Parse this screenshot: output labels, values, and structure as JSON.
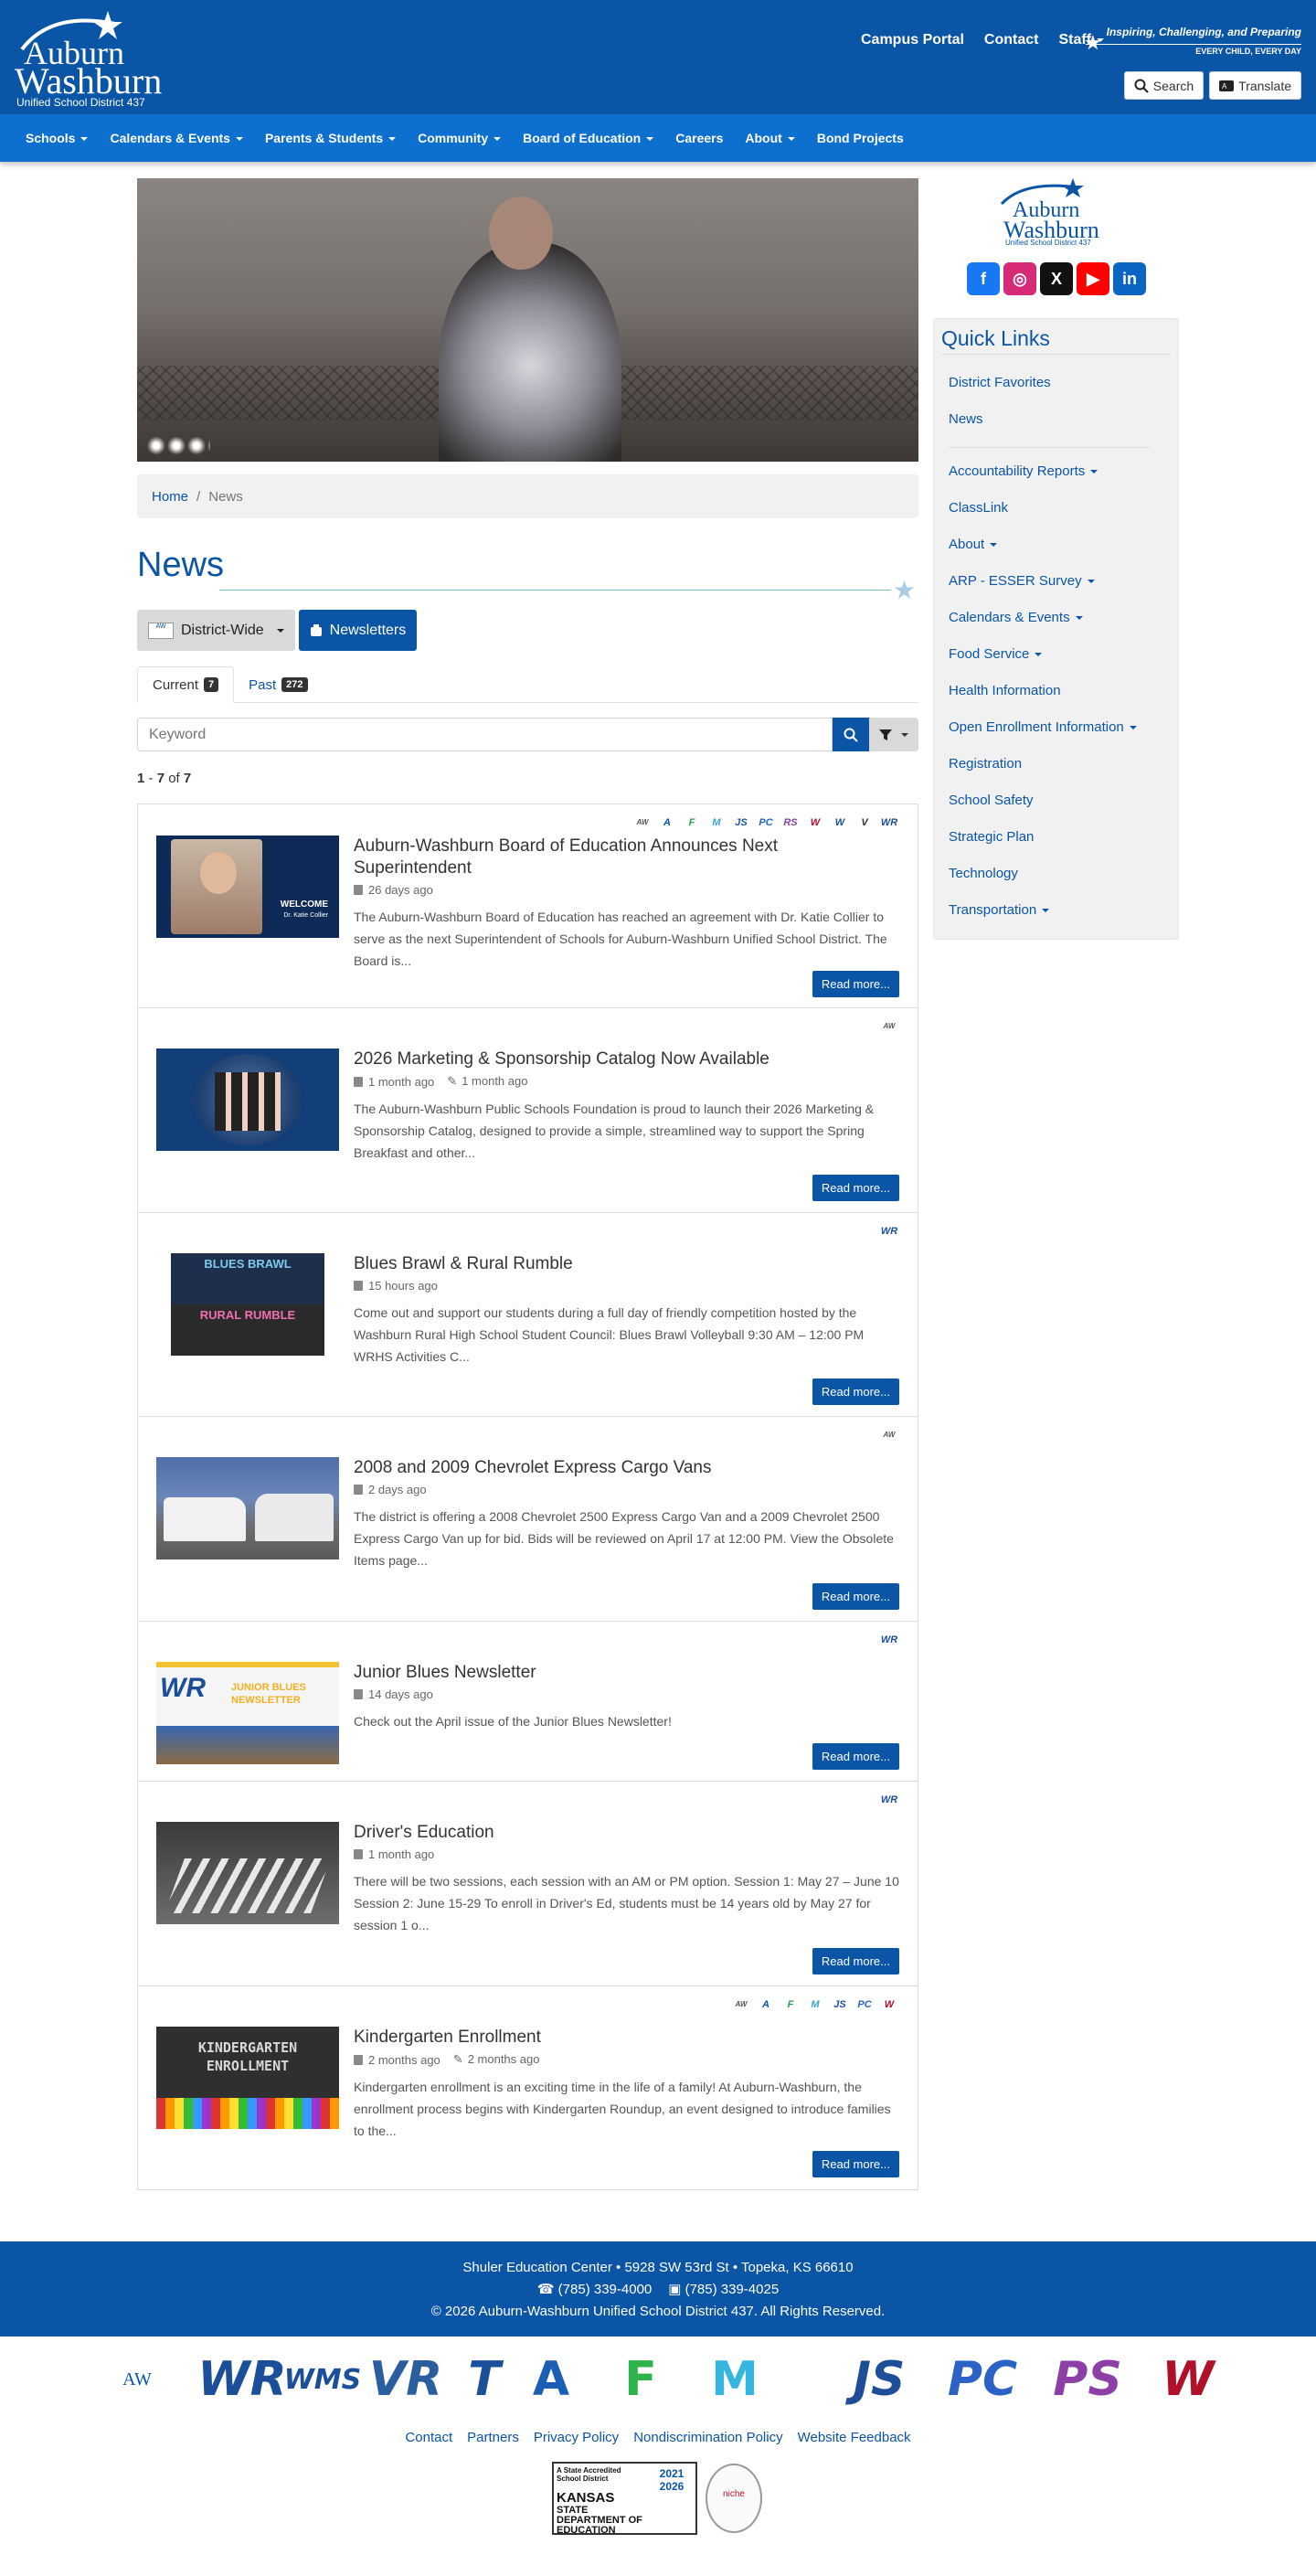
{
  "header": {
    "logo_top": "Auburn",
    "logo_bottom": "Washburn",
    "logo_sub": "Unified School District 437",
    "top_links": [
      "Campus Portal",
      "Contact",
      "Staff"
    ],
    "tagline_1": "Inspiring, Challenging, and Preparing",
    "tagline_2": "EVERY CHILD, EVERY DAY",
    "search_label": "Search",
    "translate_label": "Translate"
  },
  "nav": {
    "items": [
      {
        "label": "Schools"
      },
      {
        "label": "Calendars & Events"
      },
      {
        "label": "Parents & Students"
      },
      {
        "label": "Community"
      },
      {
        "label": "Board of Education"
      },
      {
        "label": "Careers"
      },
      {
        "label": "About"
      },
      {
        "label": "Bond Projects"
      }
    ]
  },
  "breadcrumb": {
    "home": "Home",
    "sep": "/",
    "current": "News"
  },
  "page": {
    "title": "News",
    "filter_district": "District-Wide",
    "filter_newsletters": "Newsletters",
    "tab_current": "Current",
    "tab_current_count": "7",
    "tab_past": "Past",
    "tab_past_count": "272",
    "search_placeholder": "Keyword",
    "count_from": "1",
    "count_dash": " - ",
    "count_to": "7",
    "count_of": " of ",
    "count_total": "7"
  },
  "news": [
    {
      "title": "Auburn-Washburn Board of Education Announces Next Superintendent",
      "date": "26 days ago",
      "edited": "",
      "desc": "The Auburn-Washburn Board of Education has reached an agreement with Dr. Katie Collier to serve as the next Superintendent of Schools for Auburn-Washburn Unified School District. The Board is...",
      "read": "Read more...",
      "thumb_text": "WELCOME",
      "thumb_sub": "Dr. Katie Collier"
    },
    {
      "title": "2026 Marketing & Sponsorship Catalog Now Available",
      "date": "1 month ago",
      "edited": "1 month ago",
      "desc": "The Auburn-Washburn Public Schools Foundation is proud to launch their 2026 Marketing & Sponsorship Catalog, designed to provide a simple, streamlined way to support the Spring Breakfast and other...",
      "read": "Read more..."
    },
    {
      "title": "Blues Brawl & Rural Rumble",
      "date": "15 hours ago",
      "edited": "",
      "desc": "Come out and support our students during a full day of friendly competition hosted by the Washburn Rural High School Student Council: Blues Brawl Volleyball 9:30 AM – 12:00 PM WRHS Activities C...",
      "read": "Read more...",
      "thumb_a": "BLUES BRAWL",
      "thumb_b": "RURAL RUMBLE"
    },
    {
      "title": "2008 and 2009 Chevrolet Express Cargo Vans",
      "date": "2 days ago",
      "edited": "",
      "desc": "The district is offering a 2008 Chevrolet 2500 Express Cargo Van and a 2009 Chevrolet 2500 Express Cargo Van up for bid. Bids will be reviewed on April 17 at 12:00 PM. View the Obsolete Items page...",
      "read": "Read more..."
    },
    {
      "title": "Junior Blues Newsletter",
      "date": "14 days ago",
      "edited": "",
      "desc": "Check out the April issue of the Junior Blues Newsletter!",
      "read": "Read more...",
      "thumb_a": "JUNIOR BLUES",
      "thumb_b": "NEWSLETTER"
    },
    {
      "title": "Driver's Education",
      "date": "1 month ago",
      "edited": "",
      "desc": "There will be two sessions, each session with an AM or PM option. Session 1: May 27 – June 10 Session 2: June 15-29 To enroll in Driver's Ed, students must be 14 years old by May 27 for session 1 o...",
      "read": "Read more..."
    },
    {
      "title": "Kindergarten Enrollment",
      "date": "2 months ago",
      "edited": "2 months ago",
      "desc": "Kindergarten enrollment is an exciting time in the life of a family! At Auburn-Washburn, the enrollment process begins with Kindergarten Roundup, an event designed to introduce families to the...",
      "read": "Read more...",
      "thumb_a": "KINDERGARTEN",
      "thumb_b": "ENROLLMENT"
    }
  ],
  "sidebar": {
    "logo_top": "Auburn",
    "logo_bottom": "Washburn",
    "logo_sub": "Unified School District 437",
    "quick_title": "Quick Links",
    "links": [
      "District Favorites",
      "News",
      "Accountability Reports",
      "ClassLink",
      "About",
      "ARP - ESSER Survey",
      "Calendars & Events",
      "Food Service",
      "Health Information",
      "Open Enrollment Information",
      "Registration",
      "School Safety",
      "Strategic Plan",
      "Technology",
      "Transportation"
    ]
  },
  "footer": {
    "address": "Shuler Education Center • 5928 SW 53rd St • Topeka, KS 66610",
    "phone": "(785) 339-4000",
    "fax": "(785) 339-4025",
    "copyright": "© 2026 Auburn-Washburn Unified School District 437. All Rights Reserved.",
    "links": [
      "Contact",
      "Partners",
      "Privacy Policy",
      "Nondiscrimination Policy",
      "Website Feedback"
    ],
    "accred_1": "A State Accredited School District",
    "accred_years": "2021 2026",
    "accred_state": "KANSAS",
    "accred_dept": "STATE DEPARTMENT OF EDUCATION",
    "niche": "niche"
  },
  "colors": {
    "primary": "#0a55a5",
    "nav": "#0d6fce",
    "accent_red": "#c8102e"
  }
}
